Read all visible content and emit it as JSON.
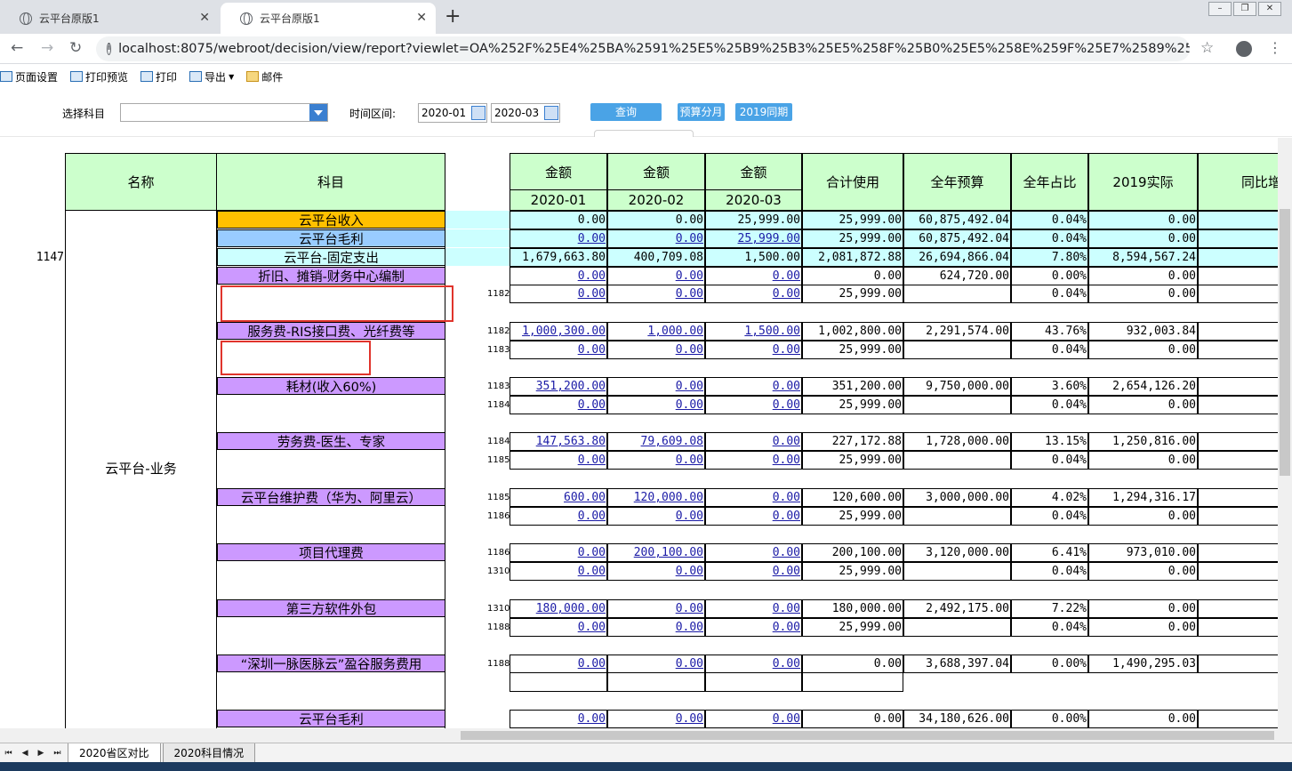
{
  "browser": {
    "tabs": [
      {
        "title": "云平台原版1"
      },
      {
        "title": "云平台原版1"
      }
    ],
    "url": "localhost:8075/webroot/decision/view/report?viewlet=OA%252F%25E4%25BA%2591%25E5%25B9%25B3%25E5%258F%25B0%25E5%258E%259F%25E7%2589%25881.cpt&op..."
  },
  "toolbar": {
    "page_setup": "页面设置",
    "print_preview": "打印预览",
    "print": "打印",
    "export": "导出",
    "mail": "邮件"
  },
  "filter": {
    "subject_label": "选择科目",
    "period_label": "时间区间:",
    "start_date": "2020-01",
    "end_date": "2020-03",
    "query": "查询",
    "budget_split": "预算分月",
    "same_period": "2019同期"
  },
  "report": {
    "headers": {
      "name": "名称",
      "subject": "科目",
      "amount": "金额",
      "months": [
        "2020-01",
        "2020-02",
        "2020-03"
      ],
      "total_used": "合计使用",
      "annual_budget": "全年预算",
      "annual_ratio": "全年占比",
      "actual_2019": "2019实际",
      "yoy": "同比增"
    },
    "top_id": "1147",
    "group_name": "云平台-业务",
    "rows": [
      {
        "subject": "云平台收入",
        "idx": "",
        "v1": "0.00",
        "v2": "0.00",
        "v3": "25,999.00",
        "total": "25,999.00",
        "budget": "60,875,492.04",
        "ratio": "0.04%",
        "actual": "0.00"
      },
      {
        "subject": "云平台毛利",
        "idx": "",
        "v1": "0.00",
        "v2": "0.00",
        "v3": "25,999.00",
        "total": "25,999.00",
        "budget": "60,875,492.04",
        "ratio": "0.04%",
        "actual": "0.00"
      },
      {
        "subject": "云平台-固定支出",
        "idx": "",
        "v1": "1,679,663.80",
        "v2": "400,709.08",
        "v3": "1,500.00",
        "total": "2,081,872.88",
        "budget": "26,694,866.04",
        "ratio": "7.80%",
        "actual": "8,594,567.24"
      },
      {
        "subject": "折旧、摊销-财务中心编制",
        "idx": "",
        "v1": "0.00",
        "v2": "0.00",
        "v3": "0.00",
        "total": "0.00",
        "budget": "624,720.00",
        "ratio": "0.00%",
        "actual": "0.00"
      },
      {
        "subject": "",
        "idx": "1182",
        "v1": "0.00",
        "v2": "0.00",
        "v3": "0.00",
        "total": "25,999.00",
        "budget": "",
        "ratio": "0.04%",
        "actual": "0.00"
      },
      {
        "subject": "服务费-RIS接口费、光纤费等",
        "idx": "1182",
        "v1": "1,000,300.00",
        "v2": "1,000.00",
        "v3": "1,500.00",
        "total": "1,002,800.00",
        "budget": "2,291,574.00",
        "ratio": "43.76%",
        "actual": "932,003.84"
      },
      {
        "subject": "",
        "idx": "1183",
        "v1": "0.00",
        "v2": "0.00",
        "v3": "0.00",
        "total": "25,999.00",
        "budget": "",
        "ratio": "0.04%",
        "actual": "0.00"
      },
      {
        "subject": "耗材(收入60%)",
        "idx": "1183",
        "v1": "351,200.00",
        "v2": "0.00",
        "v3": "0.00",
        "total": "351,200.00",
        "budget": "9,750,000.00",
        "ratio": "3.60%",
        "actual": "2,654,126.20"
      },
      {
        "subject": "",
        "idx": "1184",
        "v1": "0.00",
        "v2": "0.00",
        "v3": "0.00",
        "total": "25,999.00",
        "budget": "",
        "ratio": "0.04%",
        "actual": "0.00"
      },
      {
        "subject": "劳务费-医生、专家",
        "idx": "1184",
        "v1": "147,563.80",
        "v2": "79,609.08",
        "v3": "0.00",
        "total": "227,172.88",
        "budget": "1,728,000.00",
        "ratio": "13.15%",
        "actual": "1,250,816.00"
      },
      {
        "subject": "",
        "idx": "1185",
        "v1": "0.00",
        "v2": "0.00",
        "v3": "0.00",
        "total": "25,999.00",
        "budget": "",
        "ratio": "0.04%",
        "actual": "0.00"
      },
      {
        "subject": "云平台维护费（华为、阿里云）",
        "idx": "1185",
        "v1": "600.00",
        "v2": "120,000.00",
        "v3": "0.00",
        "total": "120,600.00",
        "budget": "3,000,000.00",
        "ratio": "4.02%",
        "actual": "1,294,316.17"
      },
      {
        "subject": "",
        "idx": "1186",
        "v1": "0.00",
        "v2": "0.00",
        "v3": "0.00",
        "total": "25,999.00",
        "budget": "",
        "ratio": "0.04%",
        "actual": "0.00"
      },
      {
        "subject": "项目代理费",
        "idx": "1186",
        "v1": "0.00",
        "v2": "200,100.00",
        "v3": "0.00",
        "total": "200,100.00",
        "budget": "3,120,000.00",
        "ratio": "6.41%",
        "actual": "973,010.00"
      },
      {
        "subject": "",
        "idx": "1310",
        "v1": "0.00",
        "v2": "0.00",
        "v3": "0.00",
        "total": "25,999.00",
        "budget": "",
        "ratio": "0.04%",
        "actual": "0.00"
      },
      {
        "subject": "第三方软件外包",
        "idx": "1310",
        "v1": "180,000.00",
        "v2": "0.00",
        "v3": "0.00",
        "total": "180,000.00",
        "budget": "2,492,175.00",
        "ratio": "7.22%",
        "actual": "0.00"
      },
      {
        "subject": "",
        "idx": "1188",
        "v1": "0.00",
        "v2": "0.00",
        "v3": "0.00",
        "total": "25,999.00",
        "budget": "",
        "ratio": "0.04%",
        "actual": "0.00"
      },
      {
        "subject": "“深圳一脉医脉云”盈谷服务费用",
        "idx": "1188",
        "v1": "0.00",
        "v2": "0.00",
        "v3": "0.00",
        "total": "0.00",
        "budget": "3,688,397.04",
        "ratio": "0.00%",
        "actual": "1,490,295.03"
      },
      {
        "subject": "",
        "idx": "",
        "v1": "",
        "v2": "",
        "v3": "",
        "total": "",
        "budget": "",
        "ratio": "",
        "actual": ""
      },
      {
        "subject": "云平台毛利",
        "idx": "",
        "v1": "0.00",
        "v2": "0.00",
        "v3": "0.00",
        "total": "0.00",
        "budget": "34,180,626.00",
        "ratio": "0.00%",
        "actual": "0.00"
      }
    ],
    "colors": {
      "header_bg": "#ccffcc",
      "income_bg": "#ffc000",
      "profit_bg": "#99ccff",
      "fixed_bg": "#ccffff",
      "item_bg": "#cc99ff",
      "highlight": "#e0342c"
    }
  },
  "sheets": [
    "2020省区对比",
    "2020科目情况"
  ]
}
